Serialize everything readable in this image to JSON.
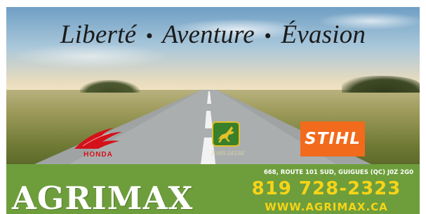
{
  "slogan": {
    "part1": "Liberté",
    "part2": "Aventure",
    "part3": "Évasion",
    "separator": "•"
  },
  "brands": {
    "honda": {
      "label": "HONDA",
      "color": "#d4111a"
    },
    "john_deere": {
      "label": "JOHN DEERE",
      "color": "#3a7f2a"
    },
    "stihl": {
      "label": "STIHL",
      "color": "#f26a1b"
    }
  },
  "footer": {
    "company": "AGRIMAX",
    "address": "668, ROUTE 101 SUD, GUIGUES (QC) J0Z 2G0",
    "phone": "819 728-2323",
    "website": "WWW.AGRIMAX.CA",
    "background": "#6e9e3c",
    "accent": "#f7d417"
  }
}
